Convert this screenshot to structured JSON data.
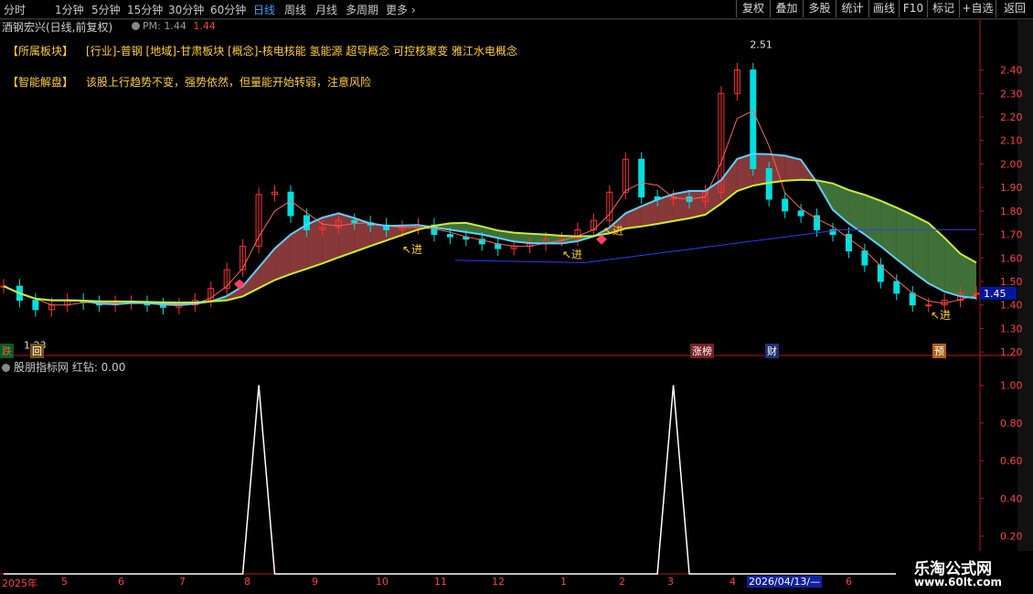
{
  "toolbar": {
    "timeframes": [
      "分时",
      "1分钟",
      "5分钟",
      "15分钟",
      "30分钟",
      "60分钟",
      "日线",
      "周线",
      "月线",
      "多周期",
      "更多 ›"
    ],
    "active_timeframe": "日线",
    "buttons": [
      "复权",
      "叠加",
      "多股",
      "统计",
      "画线",
      "F10",
      "标记",
      "+自选",
      "返回"
    ]
  },
  "header": {
    "stock_title": "酒钢宏兴(日线,前复权)",
    "pm_label": "PM: 1.44",
    "pm_value": "1.44"
  },
  "info": {
    "sector_key": "【所属板块】",
    "sector_items": "[行业]-普钢      [地域]-甘肃板块      [概念]-核电核能 氢能源 超导概念 可控核聚变 雅江水电概念",
    "analysis_key": "【智能解盘】",
    "analysis_text": "该股上行趋势不变，强势依然，但量能开始转弱，注意风险"
  },
  "main_chart": {
    "high_label": "2.51",
    "low_label": "1.23",
    "current_price": "1.45",
    "signal_label": "进",
    "badges": [
      "跌",
      "回",
      "涨榜",
      "财",
      "预"
    ]
  },
  "sub_chart": {
    "title": "股朋指标网 红钻: 0.00"
  },
  "time_axis": {
    "labels": [
      "2025年",
      "5",
      "6",
      "7",
      "8",
      "9",
      "10",
      "11",
      "12",
      "1",
      "2",
      "3",
      "4",
      "2026/04/13/—",
      "6"
    ]
  },
  "watermark": {
    "line1": "乐淘公式网",
    "line2": "www.60lt.com"
  },
  "chart_data": [
    {
      "type": "line",
      "title": "酒钢宏兴(日线,前复权)",
      "series": [
        {
          "name": "close",
          "values": [
            1.48,
            1.42,
            1.38,
            1.4,
            1.42,
            1.41,
            1.4,
            1.41,
            1.41,
            1.4,
            1.39,
            1.4,
            1.42,
            1.47,
            1.55,
            1.65,
            1.87,
            1.88,
            1.78,
            1.72,
            1.73,
            1.76,
            1.75,
            1.74,
            1.72,
            1.73,
            1.74,
            1.7,
            1.69,
            1.68,
            1.66,
            1.64,
            1.65,
            1.66,
            1.68,
            1.68,
            1.72,
            1.76,
            1.88,
            2.02,
            1.86,
            1.85,
            1.86,
            1.84,
            1.88,
            2.3,
            2.4,
            1.98,
            1.85,
            1.8,
            1.78,
            1.72,
            1.7,
            1.63,
            1.57,
            1.5,
            1.45,
            1.4,
            1.4,
            1.42,
            1.45,
            1.45
          ]
        }
      ],
      "yticks": [
        "2.40",
        "2.30",
        "2.20",
        "2.10",
        "2.00",
        "1.90",
        "1.80",
        "1.70",
        "1.60",
        "1.50",
        "1.40",
        "1.30",
        "1.20"
      ],
      "ylim": [
        1.15,
        2.55
      ],
      "xlabels": [
        "2025年",
        "5",
        "6",
        "7",
        "8",
        "9",
        "10",
        "11",
        "12",
        "1",
        "2",
        "3",
        "4",
        "2026/04/13/—",
        "6"
      ],
      "annotations": [
        "2.51",
        "1.23",
        "进",
        "1.45"
      ]
    },
    {
      "type": "line",
      "title": "股朋指标网 红钻: 0.00",
      "series": [
        {
          "name": "红钻",
          "values": [
            0,
            0,
            0,
            0,
            0,
            0,
            0,
            0,
            0,
            0,
            0,
            0,
            0,
            0,
            0,
            0,
            1,
            0,
            0,
            0,
            0,
            0,
            0,
            0,
            0,
            0,
            0,
            0,
            0,
            0,
            0,
            0,
            0,
            0,
            0,
            0,
            0,
            0,
            0,
            0,
            0,
            0,
            1,
            0,
            0,
            0,
            0,
            0,
            0,
            0,
            0,
            0,
            0,
            0,
            0,
            0,
            0,
            0,
            0,
            0,
            0,
            0
          ]
        }
      ],
      "yticks": [
        "1.00",
        "0.80",
        "0.60",
        "0.40",
        "0.20"
      ],
      "ylim": [
        0,
        1.08
      ]
    }
  ],
  "colors": {
    "up": "#ff3030",
    "down": "#00e0e0",
    "ma_cyan": "#5bd0ff",
    "ma_yellow": "#c8f030",
    "cloud_red": "#c05050",
    "cloud_green": "#5aa050",
    "blue_line": "#2040ff",
    "axis_red": "#c01010"
  }
}
